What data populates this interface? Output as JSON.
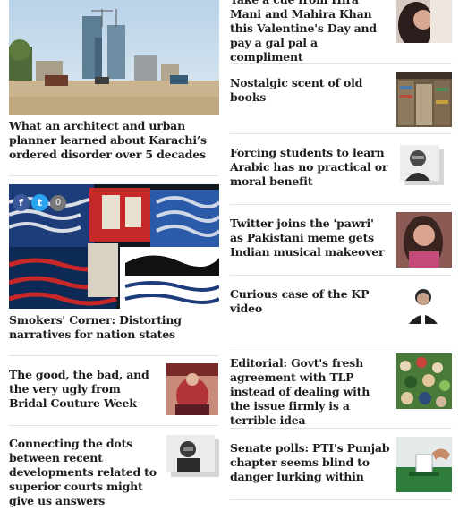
{
  "left_column": {
    "articles": [
      {
        "headline": "What an architect and urban planner learned about Karachi’s ordered disorder over 5 decades"
      },
      {
        "headline": "Smokers' Corner: Distorting narratives for nation states"
      },
      {
        "headline": "The good, the bad, and the very ugly from Bridal Couture Week"
      },
      {
        "headline": "Connecting the dots between recent developments related to superior courts might give us answers"
      }
    ],
    "share": {
      "count": "0"
    }
  },
  "right_column": {
    "articles": [
      {
        "headline": "Take a cue from Hira Mani and Mahira Khan this Valentine's Day and pay a gal pal a compliment"
      },
      {
        "headline": "Nostalgic scent of old books"
      },
      {
        "headline": "Forcing students to learn Arabic has no practical or moral benefit"
      },
      {
        "headline": "Twitter joins the 'pawri' as Pakistani meme gets Indian musical makeover"
      },
      {
        "headline": "Curious case of the KP video"
      },
      {
        "headline": "Editorial: Govt's fresh agreement with TLP instead of dealing with the issue firmly is a terrible idea"
      },
      {
        "headline": "Senate polls: PTI's Punjab chapter seems blind to danger lurking within"
      }
    ]
  }
}
